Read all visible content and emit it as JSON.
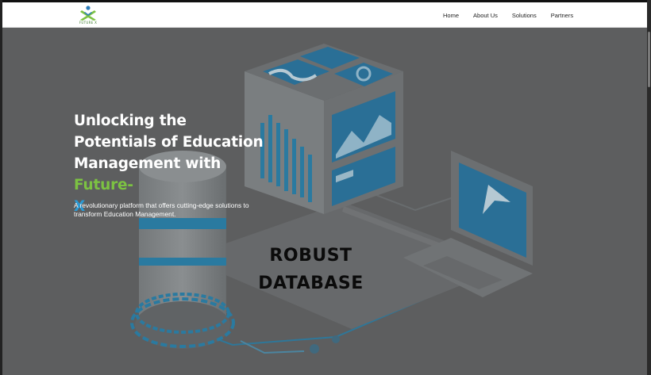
{
  "brand": {
    "name": "FUTURE X",
    "logo_icon": "future-x-logo"
  },
  "nav": {
    "items": [
      {
        "label": "Home"
      },
      {
        "label": "About Us"
      },
      {
        "label": "Solutions"
      },
      {
        "label": "Partners"
      }
    ]
  },
  "hero": {
    "headline_main": "Unlocking the Potentials of Education Management with ",
    "headline_accent": "Future-",
    "headline_x": "X",
    "subtext": "A revolutionary platform that offers cutting-edge solutions to transform Education Management.",
    "caption_line1": "ROBUST",
    "caption_line2": "DATABASE"
  },
  "colors": {
    "accent_green": "#7cc242",
    "accent_blue": "#2b9bd6",
    "illustration_blue": "#2a7aa0",
    "overlay_bg": "#5d5e5f"
  }
}
